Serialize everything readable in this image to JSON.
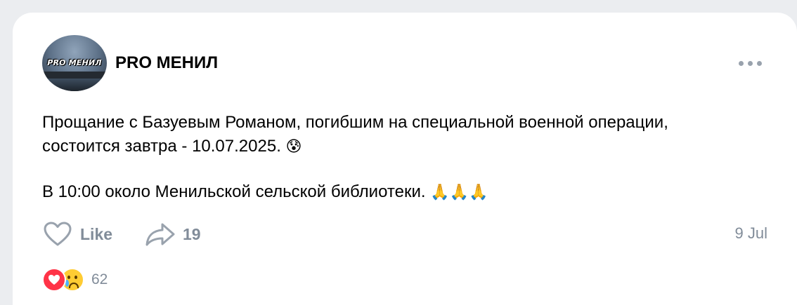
{
  "post": {
    "author": "PRO МЕНИЛ",
    "avatar_text": "PRO МЕНИЛ",
    "text_line1": "Прощание с Базуевым Романом, погибшим на специальной военной операции, состоится завтра - 10.07.2025.",
    "emoji1": "😰",
    "text_line2": "В 10:00 около Менильской сельской библиотеки.",
    "emoji2": "🙏🙏🙏",
    "date": "9 Jul"
  },
  "actions": {
    "like_label": "Like",
    "share_count": "19"
  },
  "reactions": {
    "count": "62"
  },
  "colors": {
    "background": "#ebedf0",
    "card": "#ffffff",
    "muted": "#818c99",
    "heart": "#ff3347"
  },
  "icons": [
    "more-horizontal-icon",
    "heart-outline-icon",
    "share-arrow-icon",
    "heart-reaction-icon",
    "crying-face-reaction-icon"
  ]
}
